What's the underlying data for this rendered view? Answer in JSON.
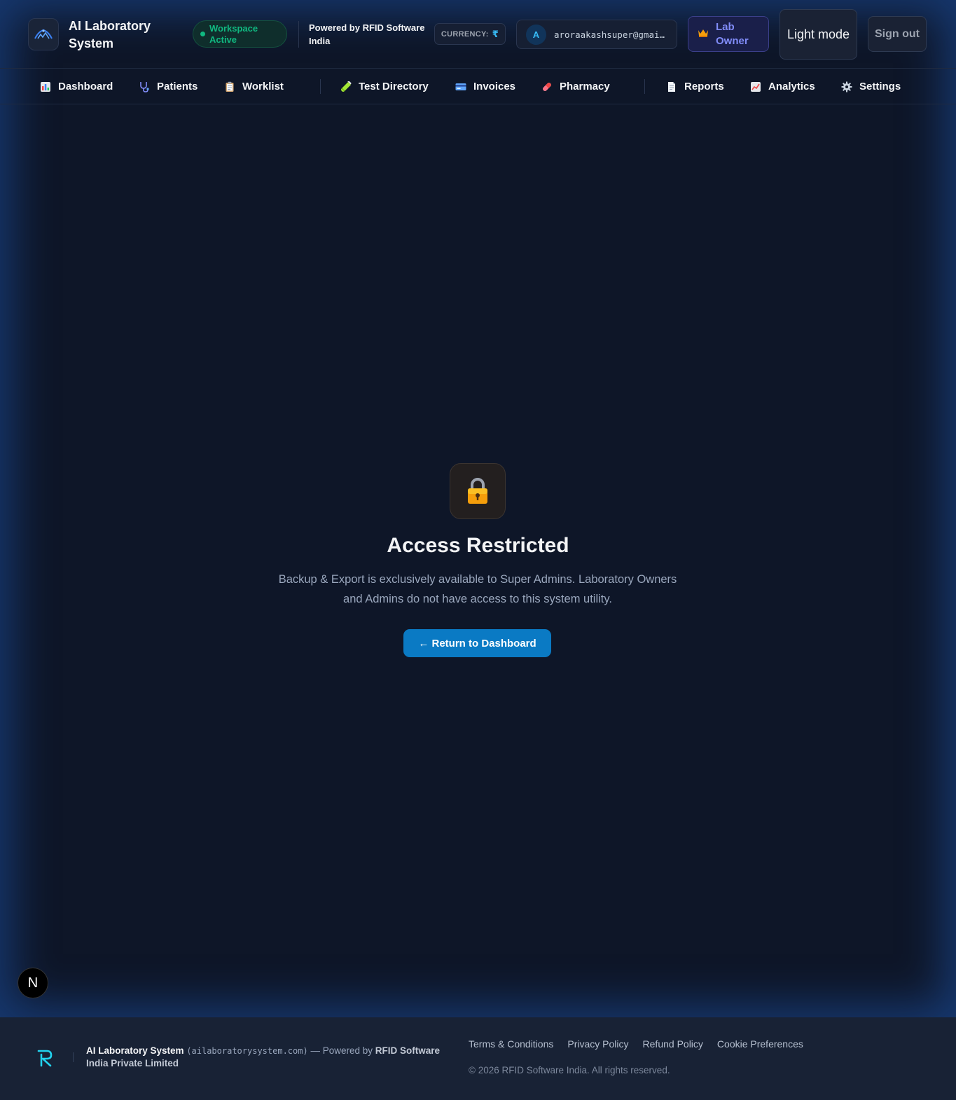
{
  "header": {
    "app_title": "AI Laboratory System",
    "workspace_status": "Workspace Active",
    "powered_by": "Powered by RFID Software India",
    "currency_label": "CURRENCY:",
    "currency_symbol": "₹",
    "user_initial": "A",
    "user_email": "aroraakashsuper@gmai…",
    "role_label": "Lab Owner",
    "theme_toggle_label": "Light mode",
    "signout_label": "Sign out"
  },
  "nav": {
    "items": [
      {
        "label": "Dashboard",
        "icon": "bar-chart-icon"
      },
      {
        "label": "Patients",
        "icon": "stethoscope-icon"
      },
      {
        "label": "Worklist",
        "icon": "clipboard-icon"
      },
      {
        "label": "Test Directory",
        "icon": "test-tube-icon"
      },
      {
        "label": "Invoices",
        "icon": "credit-card-icon"
      },
      {
        "label": "Pharmacy",
        "icon": "pill-icon"
      },
      {
        "label": "Reports",
        "icon": "document-icon"
      },
      {
        "label": "Analytics",
        "icon": "line-chart-icon"
      },
      {
        "label": "Settings",
        "icon": "gear-icon"
      }
    ]
  },
  "main": {
    "icon": "lock-icon",
    "title": "Access Restricted",
    "description": "Backup & Export is exclusively available to Super Admins. Laboratory Owners and Admins do not have access to this system utility.",
    "return_button": "← Return to Dashboard"
  },
  "floating_badge": "N",
  "footer": {
    "brand_name": "AI Laboratory System",
    "domain": "(ailaboratorysystem.com)",
    "powered_prefix": "— Powered by",
    "company": "RFID Software India Private Limited",
    "links": [
      "Terms & Conditions",
      "Privacy Policy",
      "Refund Policy",
      "Cookie Preferences"
    ],
    "copyright": "© 2026 RFID Software India. All rights reserved."
  },
  "colors": {
    "background": "#0e1628",
    "accent_button": "#0a7ac4",
    "workspace_green": "#10b981",
    "role_indigo": "#818cf8"
  }
}
